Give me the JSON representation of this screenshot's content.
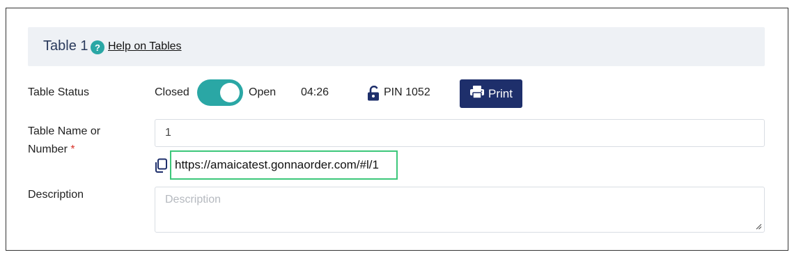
{
  "header": {
    "title": "Table 1",
    "help_icon_glyph": "?",
    "help_link": "Help on Tables"
  },
  "status": {
    "label": "Table Status",
    "closed_label": "Closed",
    "open_label": "Open",
    "is_open": true,
    "timer": "04:26",
    "pin": "PIN 1052",
    "print_label": "Print"
  },
  "name_field": {
    "label": "Table Name or Number",
    "required_mark": "*",
    "value": "1",
    "url": "https://amaicatest.gonnaorder.com/#l/1"
  },
  "description_field": {
    "label": "Description",
    "placeholder": "Description"
  },
  "colors": {
    "accent": "#2aa7a5",
    "primary_button": "#1e2f6b",
    "highlight_border": "#3cc77a",
    "header_bg": "#eef1f5",
    "required": "#d9342b"
  },
  "icons": [
    "help-icon",
    "lock-open-icon",
    "printer-icon",
    "copy-icon",
    "resize-grip-icon"
  ]
}
